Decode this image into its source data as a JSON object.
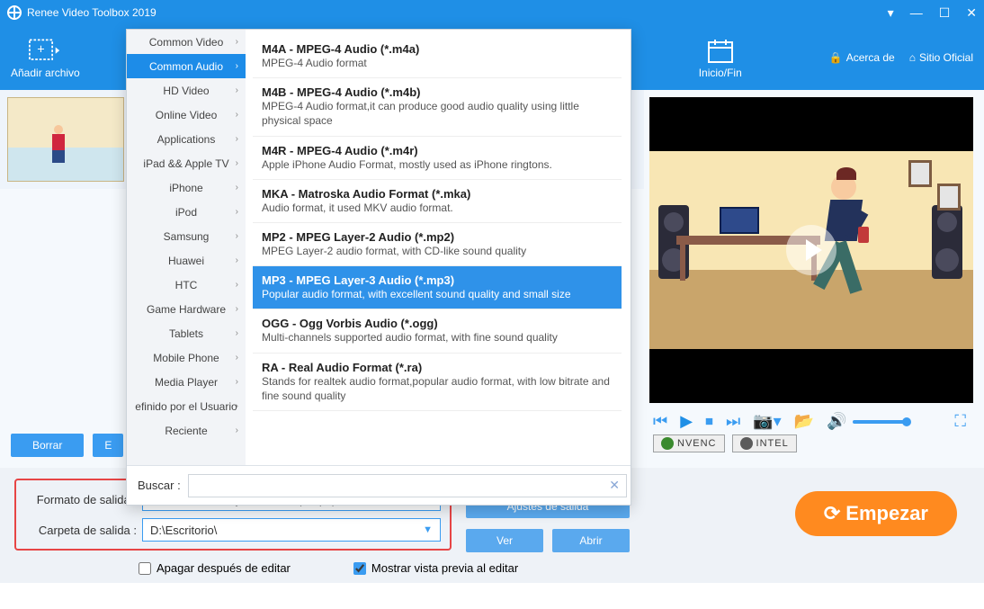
{
  "titlebar": {
    "title": "Renee Video Toolbox 2019"
  },
  "toolbar": {
    "add_file": "Añadir archivo",
    "inicio_fin": "Inicio/Fin",
    "acerca": "Acerca de",
    "sitio": "Sitio Oficial"
  },
  "buttons": {
    "borrar": "Borrar",
    "editar_placeholder": "E",
    "ajustes_salida": "Ajustes de salida",
    "ver": "Ver",
    "abrir": "Abrir",
    "empezar": "Empezar"
  },
  "output": {
    "formato_label": "Formato de salida :",
    "formato_value": "MP3 - MPEG Layer-3 Audio (*.mp3)",
    "carpeta_label": "Carpeta de salida :",
    "carpeta_value": "D:\\Escritorio\\"
  },
  "checkboxes": {
    "apagar": "Apagar después de editar",
    "preview": "Mostrar vista previa al editar"
  },
  "encoders": {
    "nvenc": "NVENC",
    "intel": "INTEL"
  },
  "dropdown": {
    "buscar_label": "Buscar :",
    "categories": [
      "Common Video",
      "Common Audio",
      "HD Video",
      "Online Video",
      "Applications",
      "iPad && Apple TV",
      "iPhone",
      "iPod",
      "Samsung",
      "Huawei",
      "HTC",
      "Game Hardware",
      "Tablets",
      "Mobile Phone",
      "Media Player",
      "efinido por el Usuario",
      "Reciente"
    ],
    "active_category": 1,
    "formats": [
      {
        "title": "M4A - MPEG-4 Audio (*.m4a)",
        "desc": "MPEG-4 Audio format"
      },
      {
        "title": "M4B - MPEG-4 Audio (*.m4b)",
        "desc": "MPEG-4 Audio format,it can produce good audio quality using little physical space"
      },
      {
        "title": "M4R - MPEG-4 Audio (*.m4r)",
        "desc": "Apple iPhone Audio Format, mostly used as iPhone ringtons."
      },
      {
        "title": "MKA - Matroska Audio Format (*.mka)",
        "desc": "Audio format, it used MKV audio format."
      },
      {
        "title": "MP2 - MPEG Layer-2 Audio (*.mp2)",
        "desc": "MPEG Layer-2 audio format, with CD-like sound quality"
      },
      {
        "title": "MP3 - MPEG Layer-3 Audio (*.mp3)",
        "desc": "Popular audio format, with excellent sound quality and small size"
      },
      {
        "title": "OGG - Ogg Vorbis Audio (*.ogg)",
        "desc": "Multi-channels supported audio format, with fine sound quality"
      },
      {
        "title": "RA - Real Audio Format (*.ra)",
        "desc": "Stands for realtek audio format,popular audio format, with low bitrate and fine sound quality"
      }
    ],
    "selected_format": 5
  }
}
